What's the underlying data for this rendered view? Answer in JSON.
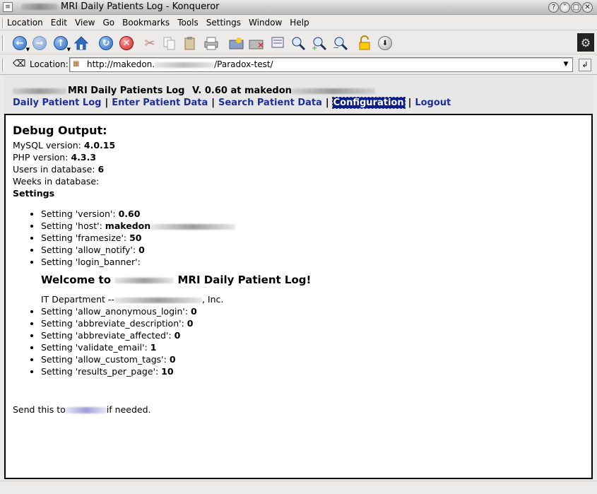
{
  "window": {
    "title": "MRI Daily Patients Log - Konqueror",
    "buttons": {
      "help": "?",
      "shade": "˅",
      "maximize": "□",
      "close": "✕"
    }
  },
  "menubar": {
    "items": [
      "Location",
      "Edit",
      "View",
      "Go",
      "Bookmarks",
      "Tools",
      "Settings",
      "Window",
      "Help"
    ]
  },
  "toolbar": {
    "icons": [
      "back-icon",
      "forward-icon",
      "up-icon",
      "home-icon",
      "reload-icon",
      "stop-icon",
      "cut-icon",
      "copy-icon",
      "paste-icon",
      "print-icon",
      "new-folder-icon",
      "delete-icon",
      "view-icon",
      "zoom-icon",
      "zoom-in-icon",
      "zoom-out-icon",
      "lock-icon",
      "download-icon",
      "konqueror-gear-icon"
    ]
  },
  "location": {
    "label": "Location:",
    "url_prefix": "http://makedon.",
    "url_suffix": "/Paradox-test/"
  },
  "header": {
    "app_name": "MRI Daily Patients Log",
    "version": "V. 0.60 at makedon"
  },
  "nav": {
    "items": [
      "Daily Patient Log",
      "Enter Patient Data",
      "Search Patient Data",
      "Configuration",
      "Logout"
    ],
    "separator": "|",
    "active": "Configuration"
  },
  "debug": {
    "title": "Debug Output:",
    "mysql_label": "MySQL version:",
    "mysql_value": "4.0.15",
    "php_label": "PHP version:",
    "php_value": "4.3.3",
    "users_label": "Users in database:",
    "users_value": "6",
    "weeks_label": "Weeks in database:",
    "weeks_value": "",
    "settings_heading": "Settings"
  },
  "settings": {
    "version": {
      "label": "Setting 'version':",
      "value": "0.60"
    },
    "host": {
      "label": "Setting 'host':",
      "value": "makedon"
    },
    "framesize": {
      "label": "Setting 'framesize':",
      "value": "50"
    },
    "allow_notify": {
      "label": "Setting 'allow_notify':",
      "value": "0"
    },
    "login_banner": {
      "label": "Setting 'login_banner':"
    },
    "banner_title_pre": "Welcome to",
    "banner_title_post": "MRI Daily Patient Log!",
    "banner_sub_pre": "IT Department --",
    "banner_sub_post": ", Inc.",
    "allow_anonymous_login": {
      "label": "Setting 'allow_anonymous_login':",
      "value": "0"
    },
    "abbreviate_description": {
      "label": "Setting 'abbreviate_description':",
      "value": "0"
    },
    "abbreviate_affected": {
      "label": "Setting 'abbreviate_affected':",
      "value": "0"
    },
    "validate_email": {
      "label": "Setting 'validate_email':",
      "value": "1"
    },
    "allow_custom_tags": {
      "label": "Setting 'allow_custom_tags':",
      "value": "0"
    },
    "results_per_page": {
      "label": "Setting 'results_per_page':",
      "value": "10"
    }
  },
  "footer": {
    "send_pre": "Send this to",
    "send_post": "if needed."
  }
}
